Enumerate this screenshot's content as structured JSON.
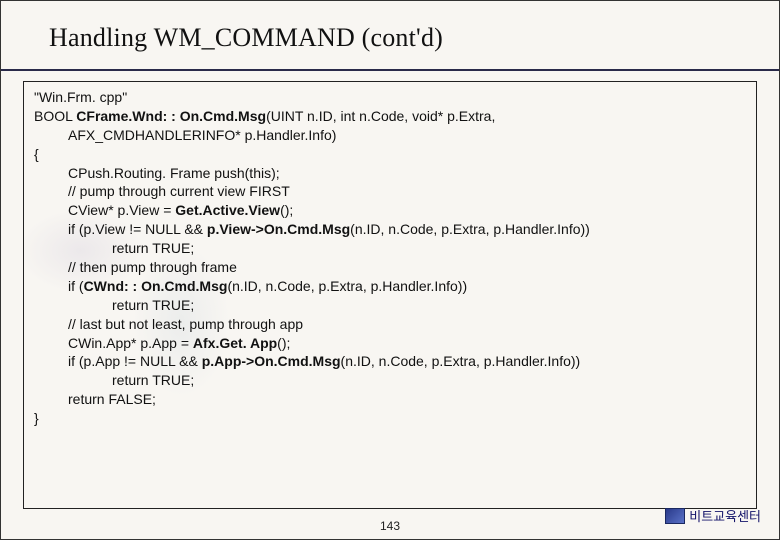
{
  "title": "Handling WM_COMMAND (cont'd)",
  "code": {
    "file_label": "\"Win.Frm. cpp\"",
    "sig1_prefix": "BOOL ",
    "sig1_bold": "CFrame.Wnd: : On.Cmd.Msg",
    "sig1_rest": "(UINT n.ID, int n.Code, void* p.Extra,",
    "sig2": "AFX_CMDHANDLERINFO* p.Handler.Info)",
    "brace_open": "{",
    "l1": "CPush.Routing. Frame push(this);",
    "l2": "// pump through current view FIRST",
    "l3_prefix": "CView* p.View = ",
    "l3_bold": "Get.Active.View",
    "l3_rest": "();",
    "l4_prefix": "if (p.View != NULL && ",
    "l4_bold": "p.View->On.Cmd.Msg",
    "l4_rest": "(n.ID, n.Code, p.Extra, p.Handler.Info))",
    "l5": "return TRUE;",
    "l6": "// then pump through frame",
    "l7_prefix": "if (",
    "l7_bold": "CWnd: : On.Cmd.Msg",
    "l7_rest": "(n.ID, n.Code, p.Extra, p.Handler.Info))",
    "l8": "return TRUE;",
    "l9": "// last but not least, pump through app",
    "l10_prefix": "CWin.App* p.App = ",
    "l10_bold": "Afx.Get. App",
    "l10_rest": "();",
    "l11_prefix": "if (p.App != NULL && ",
    "l11_bold": "p.App->On.Cmd.Msg",
    "l11_rest": "(n.ID, n.Code, p.Extra, p.Handler.Info))",
    "l12": "return TRUE;",
    "l13": "return FALSE;",
    "brace_close": "}"
  },
  "page_number": "143",
  "brand": "비트교육센터"
}
